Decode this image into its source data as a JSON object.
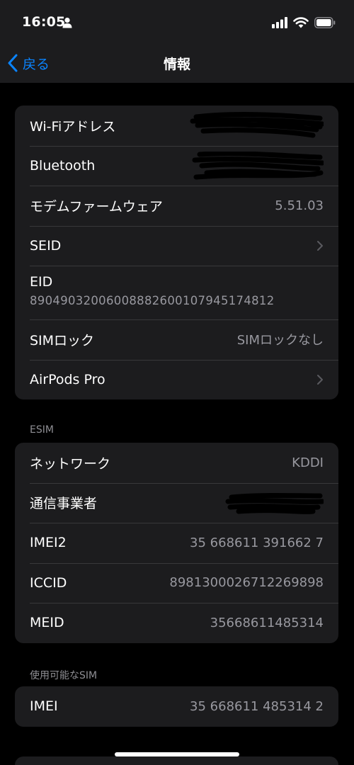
{
  "status_bar": {
    "time": "16:05",
    "icons": [
      "person-icon",
      "signal-icon",
      "wifi-icon",
      "battery-icon"
    ]
  },
  "nav": {
    "back_label": "戻る",
    "title": "情報"
  },
  "group1": {
    "rows": [
      {
        "label": "Wi-Fiアドレス",
        "value": "",
        "redacted": true
      },
      {
        "label": "Bluetooth",
        "value": "",
        "redacted": true
      },
      {
        "label": "モデムファームウェア",
        "value": "5.51.03"
      },
      {
        "label": "SEID",
        "value": "",
        "chevron": true
      },
      {
        "label": "EID",
        "value": "89049032006008882600107945174812"
      },
      {
        "label": "SIMロック",
        "value": "SIMロックなし"
      },
      {
        "label": "AirPods Pro",
        "value": "",
        "chevron": true
      }
    ]
  },
  "esim": {
    "header": "ESIM",
    "rows": [
      {
        "label": "ネットワーク",
        "value": "KDDI"
      },
      {
        "label": "通信事業者",
        "value": "",
        "redacted": true
      },
      {
        "label": "IMEI2",
        "value": "35 668611 391662 7"
      },
      {
        "label": "ICCID",
        "value": "8981300026712269898"
      },
      {
        "label": "MEID",
        "value": "35668611485314"
      }
    ]
  },
  "available_sim": {
    "header": "使用可能なSIM",
    "rows": [
      {
        "label": "IMEI",
        "value": "35 668611 485314 2"
      }
    ]
  },
  "colors": {
    "background": "#000000",
    "cell": "#1c1c1e",
    "accent": "#0a84ff",
    "secondary_text": "#98989f"
  }
}
